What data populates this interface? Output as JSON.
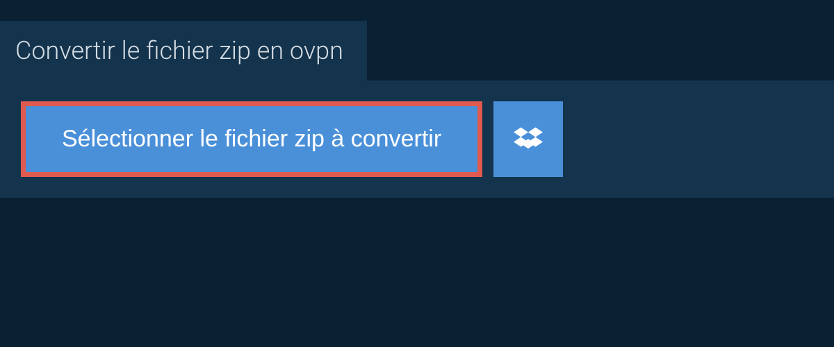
{
  "header": {
    "title": "Convertir le fichier zip en ovpn"
  },
  "upload": {
    "select_button_label": "Sélectionner le fichier zip à convertir",
    "dropbox_icon": "dropbox"
  },
  "colors": {
    "background": "#0a2033",
    "panel": "#14334d",
    "button": "#4a90d9",
    "highlight_border": "#e05a4f",
    "text_light": "#d5dde3",
    "text_white": "#ffffff"
  }
}
